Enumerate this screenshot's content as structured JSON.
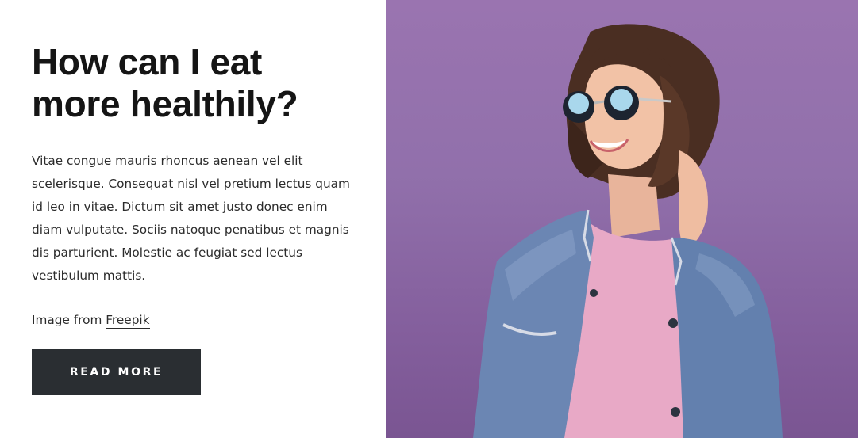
{
  "heading": {
    "line1": "How can I eat",
    "line2": "more healthily?"
  },
  "body": {
    "text": "Vitae congue mauris rhoncus aenean vel elit scelerisque. Consequat nisl vel pretium lectus quam id leo in vitae. Dictum sit amet justo donec enim diam vulputate. Sociis natoque penatibus et magnis dis parturient. Molestie ac feugiat sed lectus vestibulum mattis."
  },
  "credit": {
    "prefix": "Image from ",
    "link_label": "Freepik"
  },
  "cta": {
    "label": "READ MORE"
  },
  "colors": {
    "button_bg": "#2a2e32",
    "photo_bg": "#9170ab",
    "heading": "#151515"
  }
}
